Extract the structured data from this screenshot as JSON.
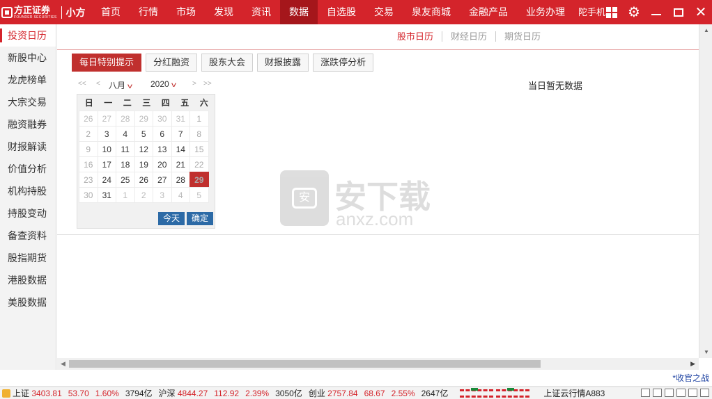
{
  "app": {
    "logo_text": "方正证券",
    "logo_sub": "FOUNDER SECURITIES",
    "brand": "小方"
  },
  "nav": {
    "items": [
      "首页",
      "行情",
      "市场",
      "发现",
      "资讯",
      "数据",
      "自选股",
      "交易",
      "泉友商城",
      "金融产品",
      "业务办理"
    ],
    "active_index": 5,
    "mobile": "陀手机"
  },
  "sidebar": {
    "items": [
      "投资日历",
      "新股中心",
      "龙虎榜单",
      "大宗交易",
      "融资融券",
      "财报解读",
      "价值分析",
      "机构持股",
      "持股变动",
      "备查资料",
      "股指期货",
      "港股数据",
      "美股数据"
    ],
    "active_index": 0
  },
  "calendar_tabs": [
    "股市日历",
    "财经日历",
    "期货日历"
  ],
  "subtabs": [
    "每日特别提示",
    "分红融资",
    "股东大会",
    "财报披露",
    "涨跌停分析"
  ],
  "no_data": "当日暂无数据",
  "calendar": {
    "nav_prev_year": "<<",
    "nav_prev_month": "<",
    "month": "八月",
    "year": "2020",
    "nav_next_month": ">",
    "nav_next_year": ">>",
    "weekdays": [
      "日",
      "一",
      "二",
      "三",
      "四",
      "五",
      "六"
    ],
    "weeks": [
      [
        "26",
        "27",
        "28",
        "29",
        "30",
        "31",
        "1"
      ],
      [
        "2",
        "3",
        "4",
        "5",
        "6",
        "7",
        "8"
      ],
      [
        "9",
        "10",
        "11",
        "12",
        "13",
        "14",
        "15"
      ],
      [
        "16",
        "17",
        "18",
        "19",
        "20",
        "21",
        "22"
      ],
      [
        "23",
        "24",
        "25",
        "26",
        "27",
        "28",
        "29"
      ],
      [
        "30",
        "31",
        "1",
        "2",
        "3",
        "4",
        "5"
      ]
    ],
    "selected": "29",
    "today_btn": "今天",
    "ok_btn": "确定"
  },
  "watermark": {
    "shield": "安",
    "text": "安下载",
    "sub": "anxz.com"
  },
  "slogan": "*收官之战",
  "statusbar": {
    "sh_label": "上证",
    "sh_index": "3403.81",
    "sh_change": "53.70",
    "sh_pct": "1.60%",
    "sh_amount": "3794亿",
    "hs_label": "沪深",
    "hs_index": "4844.27",
    "hs_change": "112.92",
    "hs_pct": "2.39%",
    "hs_amount": "3050亿",
    "cy_label": "创业",
    "cy_index": "2757.84",
    "cy_change": "68.67",
    "cy_pct": "2.55%",
    "cy_amount": "2647亿",
    "cloud": "上证云行情A883"
  },
  "colors": {
    "brand_red": "#d4242b",
    "active_nav": "#a5161b",
    "button_blue": "#2c6aa6"
  }
}
